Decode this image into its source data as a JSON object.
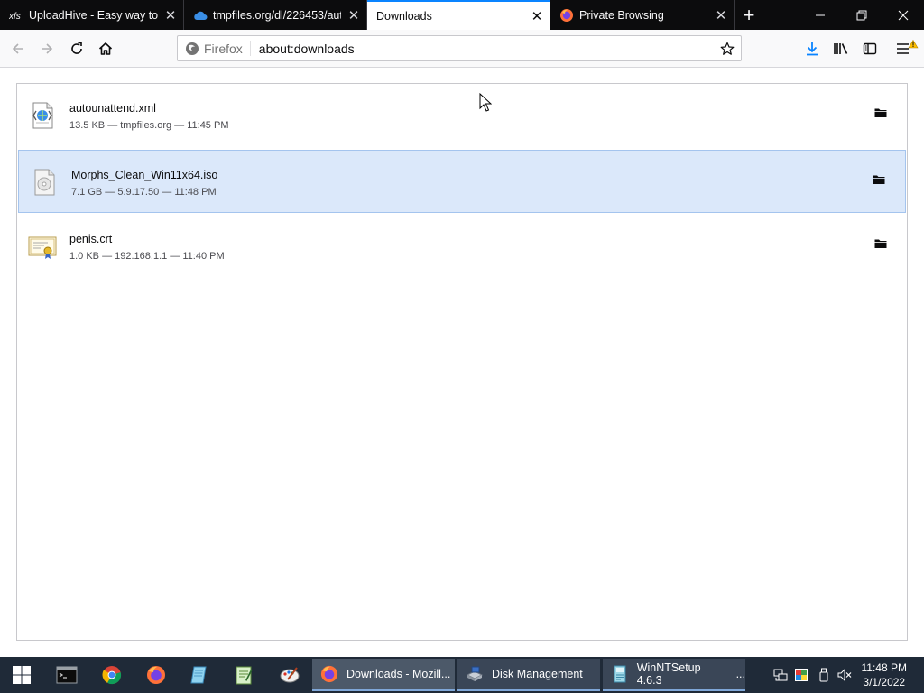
{
  "browser": {
    "tabs": [
      {
        "title": "UploadHive - Easy way to s",
        "icon": "uploadhive-favicon",
        "active": false
      },
      {
        "title": "tmpfiles.org/dl/226453/aut",
        "icon": "cloud-favicon",
        "active": false
      },
      {
        "title": "Downloads",
        "icon": "none",
        "active": true
      },
      {
        "title": "Private Browsing",
        "icon": "private-browsing-favicon",
        "active": false
      }
    ],
    "tab_close_glyph": "✕",
    "new_tab_glyph": "+",
    "window_controls": {
      "minimize": "—",
      "restore": "❐",
      "close": "✕"
    },
    "urlbar": {
      "identity_label": "Firefox",
      "url": "about:downloads"
    }
  },
  "downloads": [
    {
      "filename": "autounattend.xml",
      "status": "13.5 KB — tmpfiles.org — 11:45 PM",
      "icon": "xml-file-icon",
      "selected": false
    },
    {
      "filename": "Morphs_Clean_Win11x64.iso",
      "status": "7.1 GB — 5.9.17.50 — 11:48 PM",
      "icon": "disc-image-file-icon",
      "selected": true
    },
    {
      "filename": "penis.crt",
      "status": "1.0 KB — 192.168.1.1 — 11:40 PM",
      "icon": "certificate-file-icon",
      "selected": false
    }
  ],
  "taskbar": {
    "pinned": [
      "start-icon",
      "terminal-icon",
      "chrome-icon",
      "firefox-icon",
      "notepad-icon",
      "text-editor-icon",
      "paint-icon"
    ],
    "windows": [
      {
        "label": "Downloads - Mozill...",
        "icon": "firefox-icon",
        "state": "active"
      },
      {
        "label": "Disk Management",
        "icon": "disk-management-icon",
        "state": "open"
      },
      {
        "label": "WinNTSetup 4.6.3",
        "icon": "winntsetup-icon",
        "state": "open",
        "suffix": "..."
      }
    ],
    "clock": {
      "time": "11:48 PM",
      "date": "3/1/2022"
    }
  },
  "colors": {
    "tabstrip": "#0c0c0d",
    "accent": "#0a84ff",
    "selected_row": "#dbe8fa",
    "taskbar": "#1f2a38"
  }
}
